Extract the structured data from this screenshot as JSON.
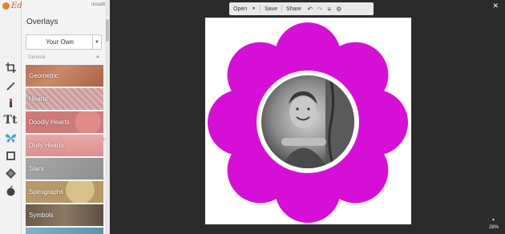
{
  "app": {
    "logo_text": "Editor",
    "user": "rissa80"
  },
  "panel": {
    "title": "Overlays",
    "dropdown_value": "Your Own",
    "section_label": "General",
    "tiles": [
      {
        "label": "Geometric"
      },
      {
        "label": "Hearts"
      },
      {
        "label": "Doodly Hearts"
      },
      {
        "label": "Doily Hearts"
      },
      {
        "label": "Stars"
      },
      {
        "label": "Spirographs"
      },
      {
        "label": "Symbols"
      }
    ]
  },
  "toolbar": {
    "open_label": "Open",
    "save_label": "Save",
    "share_label": "Share"
  },
  "view": {
    "zoom": "28%"
  },
  "colors": {
    "flower": "#d60fd6",
    "accent": "#4aa3df",
    "background": "#2b2b2b"
  }
}
